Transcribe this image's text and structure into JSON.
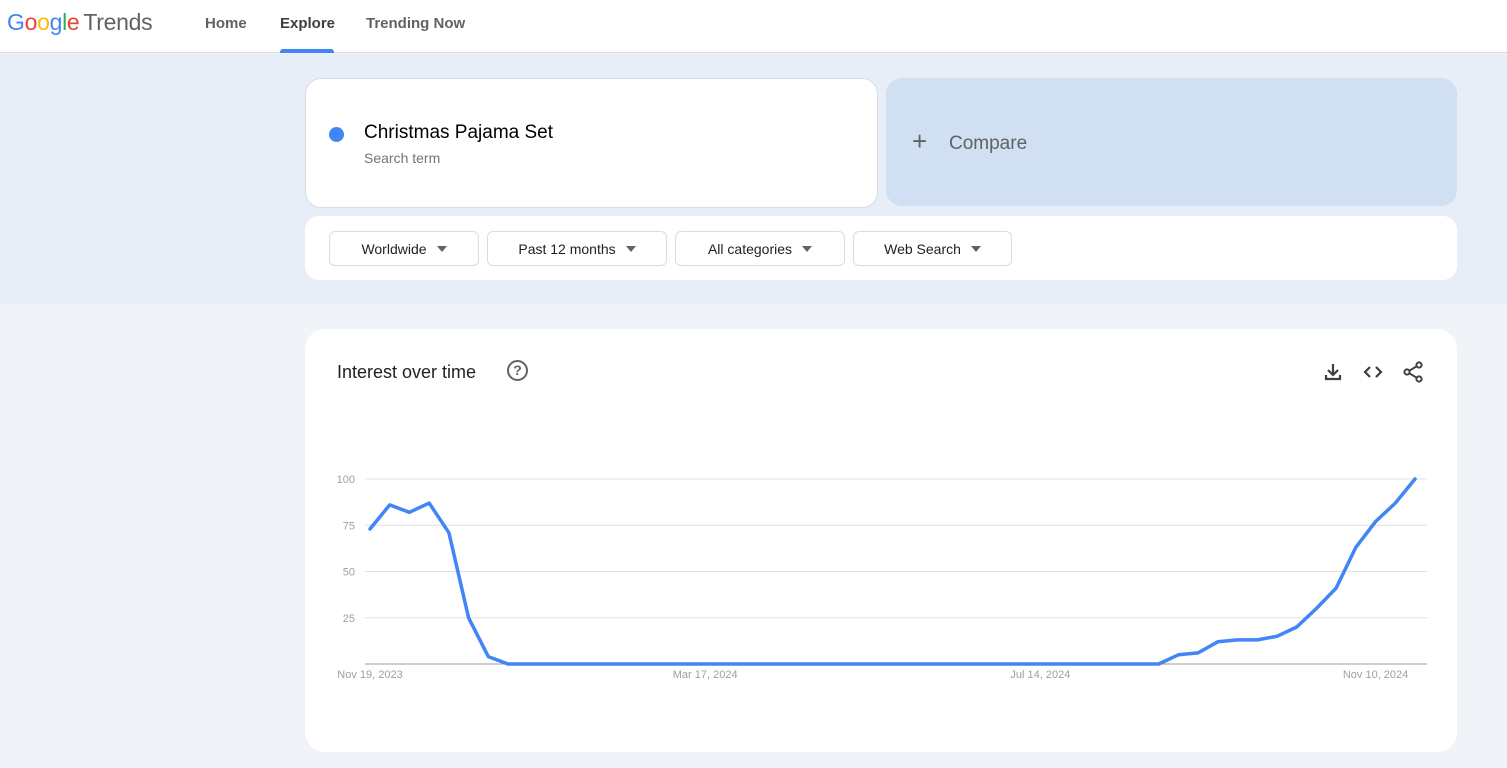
{
  "header": {
    "logo": {
      "google": [
        "G",
        "o",
        "o",
        "g",
        "l",
        "e"
      ],
      "product": "Trends"
    },
    "nav": [
      {
        "label": "Home",
        "active": false
      },
      {
        "label": "Explore",
        "active": true
      },
      {
        "label": "Trending Now",
        "active": false
      }
    ]
  },
  "search": {
    "term": "Christmas Pajama Set",
    "term_type": "Search term",
    "term_color": "#4285f4",
    "compare_icon": "+",
    "compare_label": "Compare"
  },
  "filters": [
    {
      "label": "Worldwide"
    },
    {
      "label": "Past 12 months"
    },
    {
      "label": "All categories"
    },
    {
      "label": "Web Search"
    }
  ],
  "card": {
    "title": "Interest over time",
    "help_icon": "?",
    "actions": [
      "download-icon",
      "embed-code-icon",
      "share-icon"
    ]
  },
  "chart_data": {
    "type": "line",
    "title": "Interest over time",
    "xlabel": "",
    "ylabel": "",
    "ylim": [
      0,
      100
    ],
    "yticks": [
      25,
      50,
      75,
      100
    ],
    "grid": true,
    "x_tick_labels": [
      "Nov 19, 2023",
      "Mar 17, 2024",
      "Jul 14, 2024",
      "Nov 10, 2024"
    ],
    "x_tick_indices": [
      0,
      17,
      34,
      51
    ],
    "x_start": "Nov 19, 2023",
    "x_interval": "weekly",
    "series": [
      {
        "name": "Christmas Pajama Set",
        "color": "#4285f4",
        "values": [
          73,
          86,
          82,
          87,
          71,
          25,
          4,
          0,
          0,
          0,
          0,
          0,
          0,
          0,
          0,
          0,
          0,
          0,
          0,
          0,
          0,
          0,
          0,
          0,
          0,
          0,
          0,
          0,
          0,
          0,
          0,
          0,
          0,
          0,
          0,
          0,
          0,
          0,
          0,
          0,
          0,
          5,
          6,
          12,
          13,
          13,
          15,
          20,
          30,
          41,
          63,
          77,
          87,
          100
        ]
      }
    ]
  }
}
